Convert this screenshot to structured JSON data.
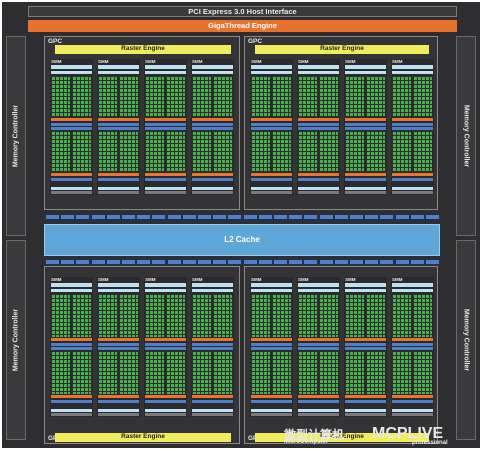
{
  "diagram": {
    "pci_label": "PCI Express 3.0 Host Interface",
    "giga_label": "GigaThread Engine",
    "memory_controller_label": "Memory Controller",
    "l2_label": "L2 Cache",
    "gpc_label": "GPC",
    "raster_label": "Raster Engine",
    "smm_label": "SMM",
    "colors": {
      "die_background": "#2e2e30",
      "giga_engine": "#e8712b",
      "raster_engine": "#f0ec5c",
      "l2_cache": "#5fa7d8",
      "cuda_core": "#46b04a",
      "sfu_unit": "#e8742d",
      "ld_st_unit": "#4f7fc9"
    }
  },
  "watermark": {
    "cn_text": "微型计算机",
    "en_text": "MicroComputer",
    "logo": "MCPLIVE",
    "sub": "professional"
  }
}
